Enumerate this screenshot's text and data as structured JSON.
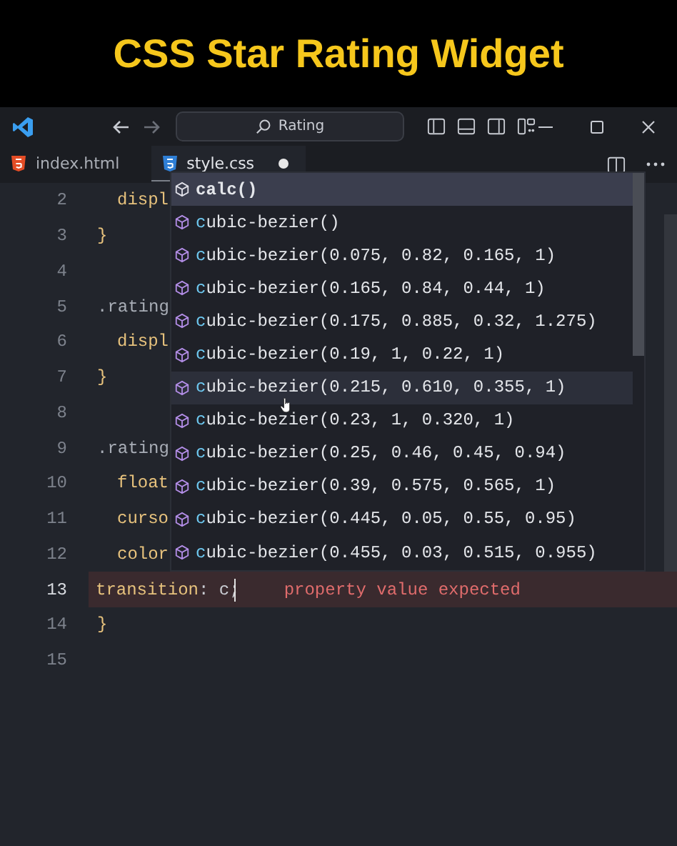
{
  "banner": {
    "title": "CSS Star Rating Widget"
  },
  "titlebar": {
    "search": {
      "value": "Rating"
    }
  },
  "tabs": [
    {
      "label": "index.html",
      "kind": "html",
      "selected": false,
      "modified": false
    },
    {
      "label": "style.css",
      "kind": "css",
      "selected": true,
      "modified": true
    }
  ],
  "editor": {
    "lines": [
      {
        "number": "2",
        "kind": "declaration",
        "segments": [
          {
            "text": "displ",
            "kind": "property"
          }
        ]
      },
      {
        "number": "3",
        "kind": "rule",
        "segments": [
          {
            "text": "}",
            "kind": "brace"
          }
        ]
      },
      {
        "number": "4",
        "kind": "blank"
      },
      {
        "number": "5",
        "kind": "rule",
        "segments": [
          {
            "text": ".rating",
            "kind": "selector"
          }
        ]
      },
      {
        "number": "6",
        "kind": "declaration",
        "segments": [
          {
            "text": "displ",
            "kind": "property"
          }
        ]
      },
      {
        "number": "7",
        "kind": "rule",
        "segments": [
          {
            "text": "}",
            "kind": "brace"
          }
        ]
      },
      {
        "number": "8",
        "kind": "blank"
      },
      {
        "number": "9",
        "kind": "rule",
        "segments": [
          {
            "text": ".rating",
            "kind": "selector"
          }
        ]
      },
      {
        "number": "10",
        "kind": "declaration",
        "segments": [
          {
            "text": "float",
            "kind": "property"
          }
        ]
      },
      {
        "number": "11",
        "kind": "declaration",
        "segments": [
          {
            "text": "curso",
            "kind": "property"
          }
        ]
      },
      {
        "number": "12",
        "kind": "declaration",
        "segments": [
          {
            "text": "color",
            "kind": "property"
          }
        ]
      },
      {
        "number": "13",
        "kind": "declaration",
        "current": true,
        "segments": [
          {
            "text": "transition",
            "kind": "property"
          },
          {
            "text": ": c;",
            "kind": "plain"
          }
        ],
        "error": "property value expected"
      },
      {
        "number": "14",
        "kind": "rule",
        "segments": [
          {
            "text": "}",
            "kind": "brace"
          }
        ]
      },
      {
        "number": "15",
        "kind": "blank"
      }
    ],
    "suggestions": [
      {
        "label": "calc()",
        "selected": true,
        "hovered": false
      },
      {
        "label": "cubic-bezier()",
        "selected": false,
        "hovered": false
      },
      {
        "label": "cubic-bezier(0.075, 0.82, 0.165, 1)",
        "selected": false,
        "hovered": false
      },
      {
        "label": "cubic-bezier(0.165, 0.84, 0.44, 1)",
        "selected": false,
        "hovered": false
      },
      {
        "label": "cubic-bezier(0.175, 0.885, 0.32, 1.275)",
        "selected": false,
        "hovered": false
      },
      {
        "label": "cubic-bezier(0.19, 1, 0.22, 1)",
        "selected": false,
        "hovered": false
      },
      {
        "label": "cubic-bezier(0.215, 0.610, 0.355, 1)",
        "selected": false,
        "hovered": true
      },
      {
        "label": "cubic-bezier(0.23, 1, 0.320, 1)",
        "selected": false,
        "hovered": false
      },
      {
        "label": "cubic-bezier(0.25, 0.46, 0.45, 0.94)",
        "selected": false,
        "hovered": false
      },
      {
        "label": "cubic-bezier(0.39, 0.575, 0.565, 1)",
        "selected": false,
        "hovered": false
      },
      {
        "label": "cubic-bezier(0.445, 0.05, 0.55, 0.95)",
        "selected": false,
        "hovered": false
      },
      {
        "label": "cubic-bezier(0.455, 0.03, 0.515, 0.955)",
        "selected": false,
        "hovered": false
      }
    ]
  }
}
